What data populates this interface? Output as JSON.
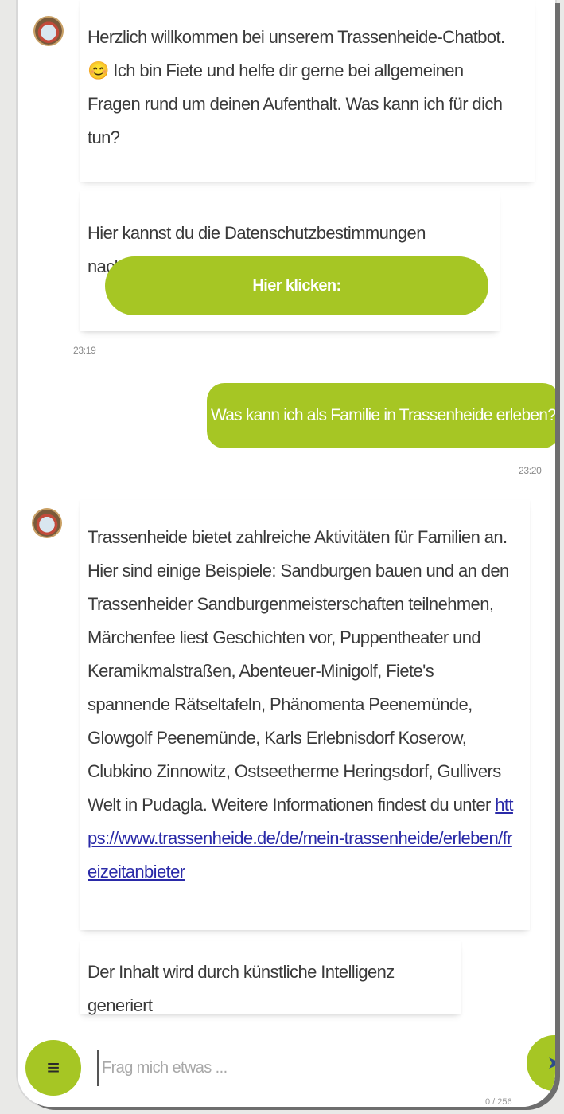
{
  "messages": {
    "welcome_text": "Herzlich willkommen bei unserem Trassenheide-Chatbot. 😊 Ich bin Fiete und helfe dir gerne bei allgemeinen Fragen rund um deinen Aufenthalt. Was kann ich für dich tun?",
    "privacy_text": "Hier kannst du die Datenschutzbestimmungen nachlesen:",
    "privacy_button_label": "Hier klicken:",
    "bot_timestamp_1": "23:19",
    "user_question": "Was kann ich als Familie in Trassenheide erleben?",
    "user_timestamp": "23:20",
    "answer_text": "Trassenheide bietet zahlreiche Aktivitäten für Familien an. Hier sind einige Beispiele: Sandburgen bauen und an den Trassenheider Sandburgenmeisterschaften teilnehmen, Märchenfee liest Geschichten vor, Puppentheater und Keramikmalstraßen, Abenteuer-Minigolf, Fiete's spannende Rätseltafeln, Phänomenta Peenemünde, Glowgolf Peenemünde, Karls Erlebnisdorf Koserow, Clubkino Zinnowitz, Ostseetherme Heringsdorf, Gullivers Welt in Pudagla. Weitere Informationen findest du unter",
    "answer_link": "https://www.trassenheide.de/de/mein-trassenheide/erleben/freizeitanbieter",
    "ai_disclaimer": "Der Inhalt wird durch künstliche Intelligenz generiert"
  },
  "input": {
    "placeholder": "Frag mich etwas ...",
    "counter": "0 / 256"
  },
  "icons": {
    "menu": "menu-icon",
    "send": "send-icon",
    "avatar": "bot-avatar-icon"
  },
  "colors": {
    "accent": "#a6c624",
    "link": "#2a2aa8"
  }
}
